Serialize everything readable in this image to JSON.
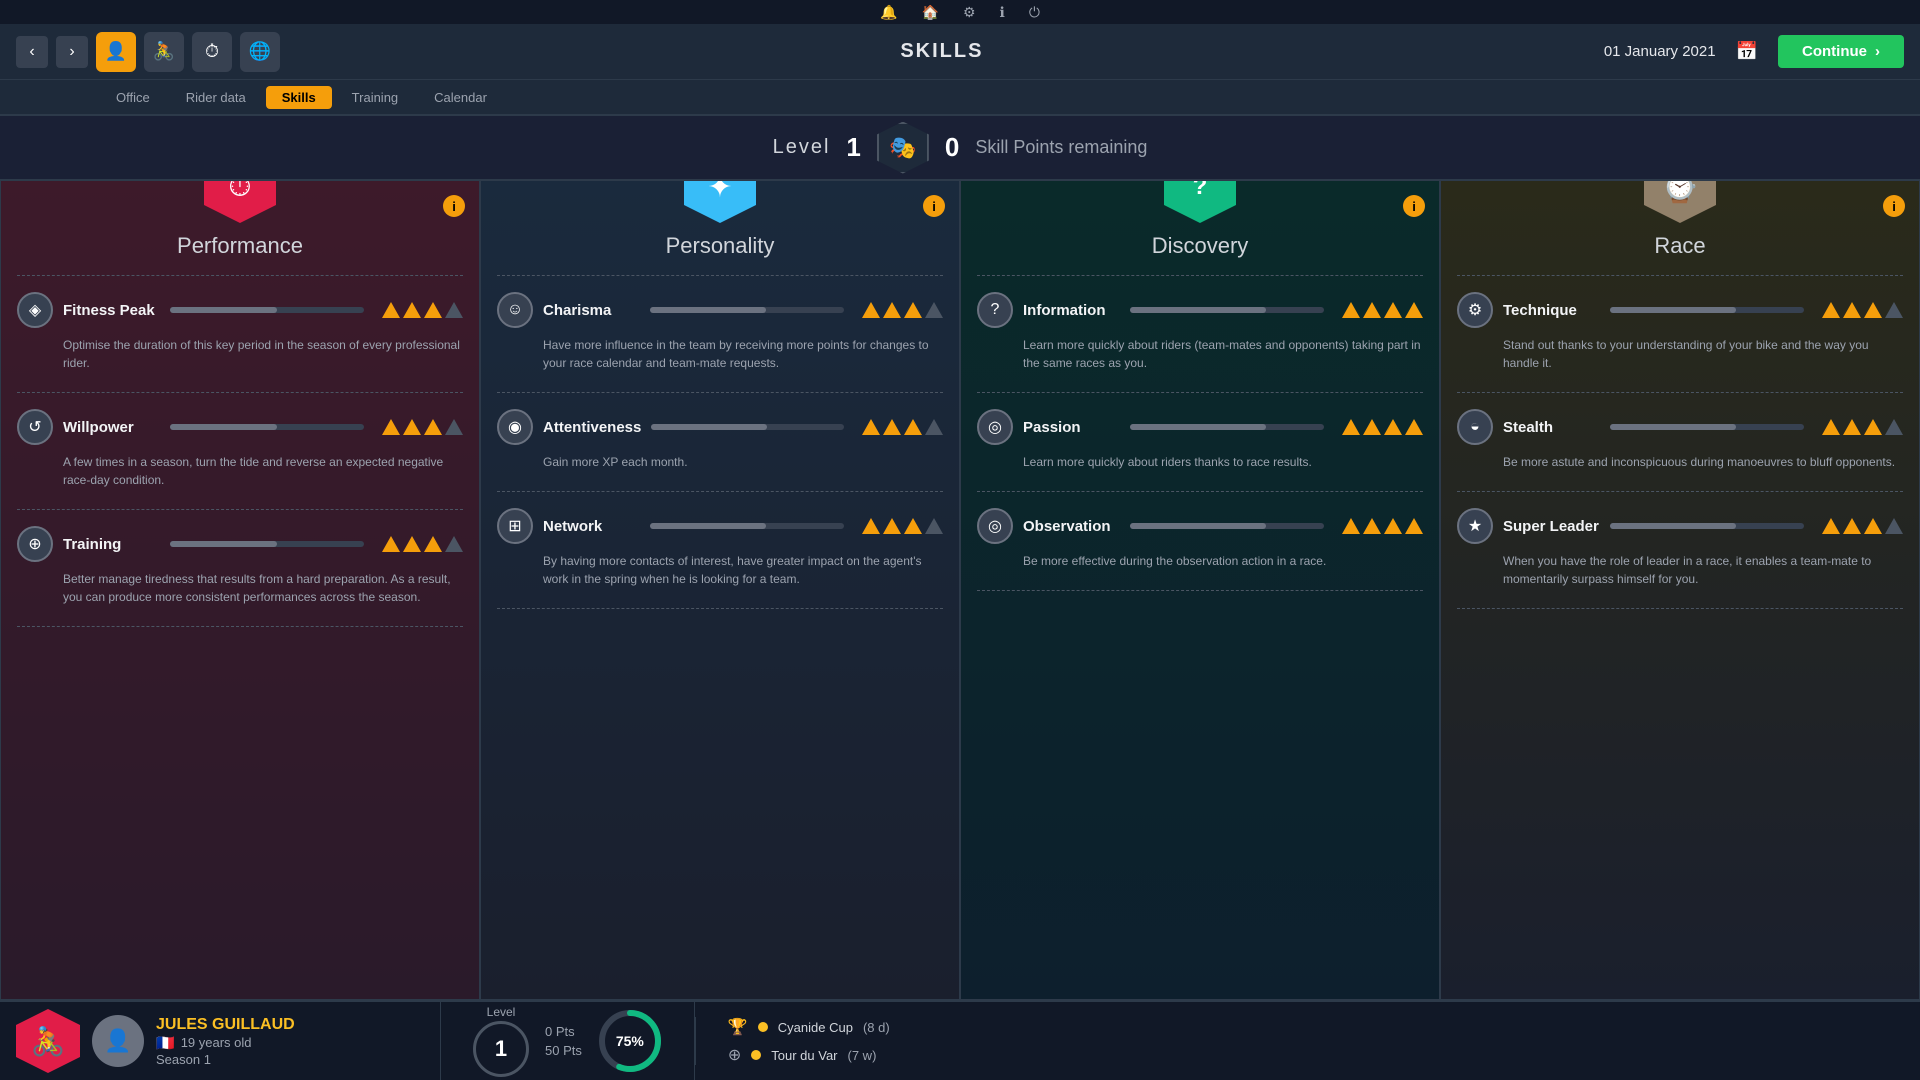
{
  "topbar": {
    "icons": [
      "bell",
      "home",
      "gear",
      "info",
      "power"
    ]
  },
  "navbar": {
    "title": "SKILLS",
    "date": "01 January 2021",
    "continue_label": "Continue",
    "nav_icons": [
      "person",
      "cycling",
      "clock",
      "globe"
    ]
  },
  "subnav": {
    "items": [
      {
        "label": "Office",
        "active": false
      },
      {
        "label": "Rider data",
        "active": false
      },
      {
        "label": "Skills",
        "active": true
      },
      {
        "label": "Training",
        "active": false
      },
      {
        "label": "Calendar",
        "active": false
      }
    ]
  },
  "level_bar": {
    "level_prefix": "Level",
    "level": "1",
    "skill_pts": "0",
    "skill_pts_suffix": "Skill Points remaining"
  },
  "cards": [
    {
      "id": "performance",
      "title": "Performance",
      "hex_color": "performance",
      "icon": "⏱",
      "skills": [
        {
          "name": "Fitness Peak",
          "icon": "◈",
          "desc": "Optimise the duration of this key period in the season of every professional rider.",
          "triangles": [
            1,
            1,
            1,
            0
          ],
          "bar_pct": 55
        },
        {
          "name": "Willpower",
          "icon": "↺",
          "desc": "A few times in a season, turn the tide and reverse an expected negative race-day condition.",
          "triangles": [
            1,
            1,
            1,
            0
          ],
          "bar_pct": 55
        },
        {
          "name": "Training",
          "icon": "⊕",
          "desc": "Better manage tiredness that results from a hard preparation. As a result, you can produce more consistent performances across the season.",
          "triangles": [
            1,
            1,
            1,
            0
          ],
          "bar_pct": 55
        }
      ]
    },
    {
      "id": "personality",
      "title": "Personality",
      "hex_color": "personality",
      "icon": "✦",
      "skills": [
        {
          "name": "Charisma",
          "icon": "☺",
          "desc": "Have more influence in the team by receiving more points for changes to your race calendar and team-mate requests.",
          "triangles": [
            1,
            1,
            1,
            0
          ],
          "bar_pct": 60
        },
        {
          "name": "Attentiveness",
          "icon": "◉",
          "desc": "Gain more XP each month.",
          "triangles": [
            1,
            1,
            1,
            0
          ],
          "bar_pct": 60
        },
        {
          "name": "Network",
          "icon": "⊞",
          "desc": "By having more contacts of interest, have greater impact on the agent's work in the spring when he is looking for a team.",
          "triangles": [
            1,
            1,
            1,
            0
          ],
          "bar_pct": 60
        }
      ]
    },
    {
      "id": "discovery",
      "title": "Discovery",
      "hex_color": "discovery",
      "icon": "?",
      "skills": [
        {
          "name": "Information",
          "icon": "?",
          "desc": "Learn more quickly about riders (team-mates and opponents) taking part in the same races as you.",
          "triangles": [
            1,
            1,
            1,
            1
          ],
          "bar_pct": 70
        },
        {
          "name": "Passion",
          "icon": "◎",
          "desc": "Learn more quickly about riders thanks to race results.",
          "triangles": [
            1,
            1,
            1,
            1
          ],
          "bar_pct": 70
        },
        {
          "name": "Observation",
          "icon": "◎",
          "desc": "Be more effective during the observation action in a race.",
          "triangles": [
            1,
            1,
            1,
            1
          ],
          "bar_pct": 70
        }
      ]
    },
    {
      "id": "race",
      "title": "Race",
      "hex_color": "race",
      "icon": "⌚",
      "skills": [
        {
          "name": "Technique",
          "icon": "⚙",
          "desc": "Stand out thanks to your understanding of your bike and the way you handle it.",
          "triangles": [
            1,
            1,
            1,
            0
          ],
          "bar_pct": 65
        },
        {
          "name": "Stealth",
          "icon": "◒",
          "desc": "Be more astute and inconspicuous during manoeuvres to bluff opponents.",
          "triangles": [
            1,
            1,
            1,
            0
          ],
          "bar_pct": 65
        },
        {
          "name": "Super Leader",
          "icon": "★",
          "desc": "When you have the role of leader in a race, it enables a team-mate to momentarily surpass himself for you.",
          "triangles": [
            1,
            1,
            1,
            0
          ],
          "bar_pct": 65
        }
      ]
    }
  ],
  "bottombar": {
    "player": {
      "name": "JULES GUILLAUD",
      "age": "19 years old",
      "season": "Season 1",
      "flag": "🇫🇷"
    },
    "level": {
      "label": "Level",
      "value": "1",
      "pts_current": "0 Pts",
      "pts_total": "50 Pts",
      "progress": "75%"
    },
    "races": [
      {
        "icon": "🏆",
        "name": "Cyanide Cup",
        "detail": "(8 d)"
      },
      {
        "icon": "⊕",
        "name": "Tour du Var",
        "detail": "(7 w)"
      }
    ]
  }
}
